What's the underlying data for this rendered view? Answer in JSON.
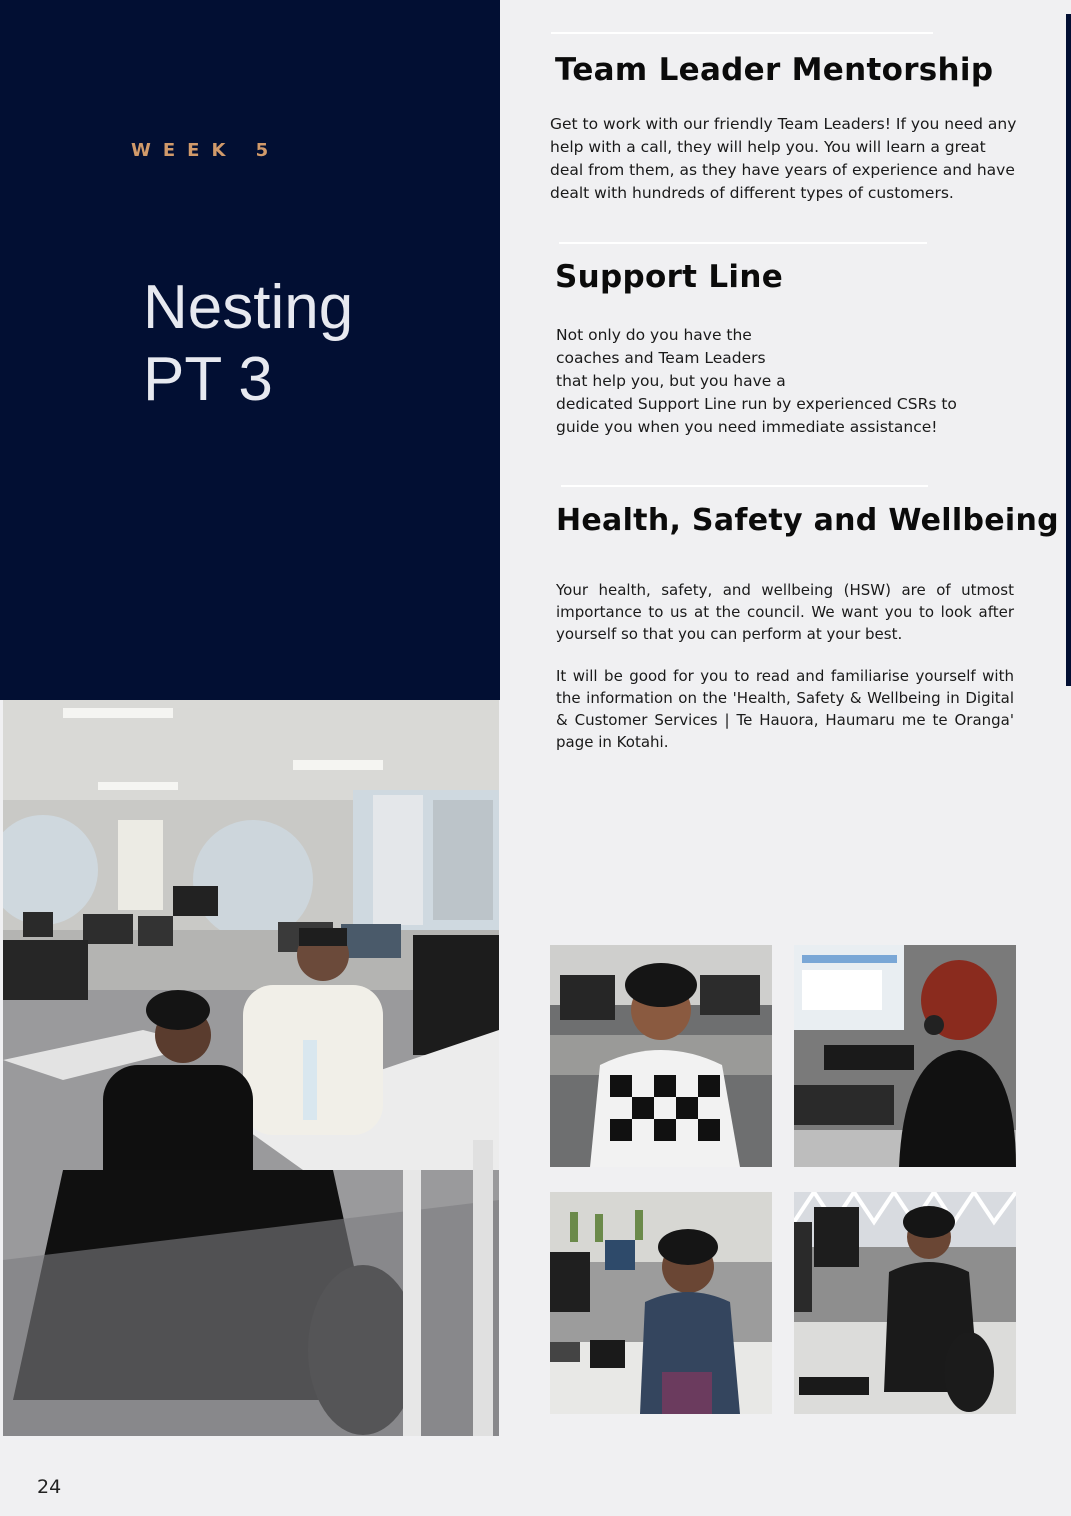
{
  "hero": {
    "week_label": "WEEK 5",
    "title_line1": "Nesting",
    "title_line2": "PT 3"
  },
  "sections": [
    {
      "heading": "Team Leader Mentorship",
      "lines": [
        "Get to work with our friendly Team Leaders! If you need any",
        "help with a call, they will help you. You will learn a great",
        "deal from them, as they have years of experience and have",
        "dealt with hundreds of different types of customers."
      ]
    },
    {
      "heading": "Support Line",
      "lines": [
        "Not only do you have the",
        "coaches and Team Leaders",
        "that help you, but you have a",
        "dedicated Support Line run by experienced CSRs to",
        "guide you when you need immediate assistance!"
      ]
    },
    {
      "heading": "Health, Safety and Wellbeing",
      "paragraphs": [
        "Your health, safety, and wellbeing (HSW) are of utmost importance to us at the council. We want you to look after yourself so that you can perform at your best.",
        "It will be good for you to read and familiarise yourself with the information on the 'Health, Safety & Wellbeing in Digital & Customer Services | Te Hauora, Haumaru me te Oranga' page in Kotahi."
      ]
    }
  ],
  "page_number": "24",
  "colors": {
    "navy": "#020f33",
    "accent": "#d19a6a",
    "page_bg": "#f0f0f2"
  }
}
